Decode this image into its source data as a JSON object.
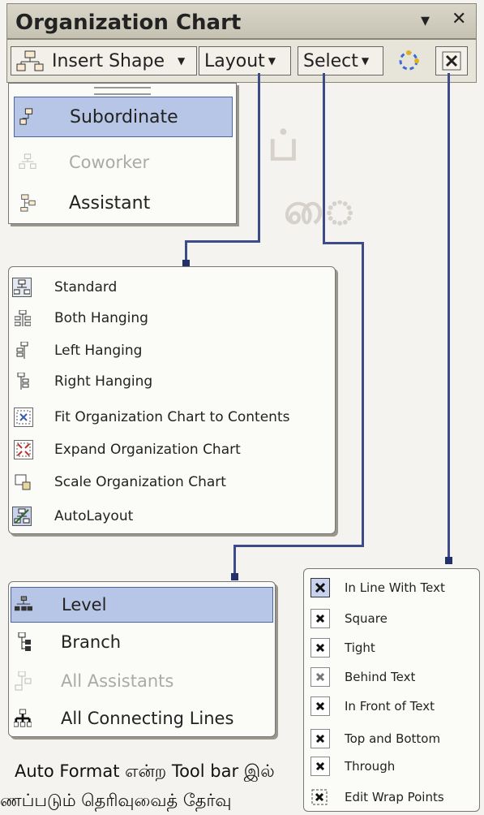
{
  "window": {
    "title": "Organization Chart",
    "dropdown_glyph": "▾",
    "close_glyph": "✕"
  },
  "toolbar": {
    "insert_shape": "Insert Shape",
    "layout": "Layout",
    "select": "Select"
  },
  "insert_menu": {
    "items": [
      {
        "label": "Subordinate",
        "state": "highlighted"
      },
      {
        "label": "Coworker",
        "state": "disabled"
      },
      {
        "label": "Assistant",
        "state": "normal"
      }
    ]
  },
  "layout_menu": {
    "items": [
      {
        "label": "Standard"
      },
      {
        "label": "Both Hanging"
      },
      {
        "label": "Left Hanging"
      },
      {
        "label": "Right Hanging"
      },
      {
        "label": "Fit Organization Chart to Contents"
      },
      {
        "label": "Expand Organization Chart"
      },
      {
        "label": "Scale Organization Chart"
      },
      {
        "label": "AutoLayout"
      }
    ]
  },
  "select_menu": {
    "items": [
      {
        "label": "Level",
        "state": "highlighted"
      },
      {
        "label": "Branch",
        "state": "normal"
      },
      {
        "label": "All Assistants",
        "state": "disabled"
      },
      {
        "label": "All Connecting Lines",
        "state": "normal"
      }
    ]
  },
  "wrap_menu": {
    "items": [
      {
        "label": "In Line With Text"
      },
      {
        "label": "Square"
      },
      {
        "label": "Tight"
      },
      {
        "label": "Behind Text"
      },
      {
        "label": "In Front of Text"
      },
      {
        "label": "Top and Bottom"
      },
      {
        "label": "Through"
      },
      {
        "label": "Edit Wrap Points"
      }
    ]
  },
  "caption": {
    "line1": "Auto Format என்ற Tool bar இல்",
    "line2": "ணப்படும் தெரிவுவைத் தேர்வு"
  },
  "colors": {
    "highlight": "#b7c6e6",
    "connector": "#3c4c8a"
  }
}
